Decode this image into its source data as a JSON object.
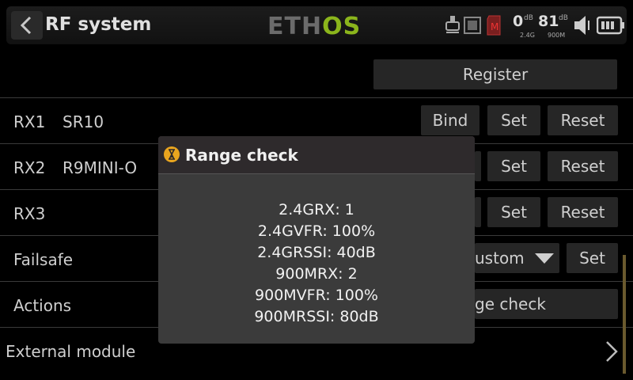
{
  "header": {
    "title": "RF system",
    "logo_part1": "ETH",
    "logo_part2": "OS",
    "telemetry": [
      {
        "value": "0",
        "unit": "dB",
        "band": "2.4G"
      },
      {
        "value": "81",
        "unit": "dB",
        "band": "900M"
      }
    ],
    "icons": [
      "joystick-icon",
      "record-icon",
      "memory-card-icon",
      "speaker-icon",
      "battery-icon"
    ]
  },
  "register_button": "Register",
  "receivers": [
    {
      "slot": "RX1",
      "name": "SR10",
      "bind": "Bind",
      "set": "Set",
      "reset": "Reset"
    },
    {
      "slot": "RX2",
      "name": "R9MINI-O",
      "set": "Set",
      "reset": "Reset"
    },
    {
      "slot": "RX3",
      "name": "",
      "set": "Set",
      "reset": "Reset"
    }
  ],
  "failsafe": {
    "label": "Failsafe",
    "mode": "ustom",
    "set": "Set"
  },
  "actions": {
    "label": "Actions",
    "button": "ge check"
  },
  "external_module": {
    "label": "External module"
  },
  "dialog": {
    "title": "Range check",
    "lines": [
      "2.4GRX: 1",
      "2.4GVFR: 100%",
      "2.4GRSSI: 40dB",
      "900MRX: 2",
      "900MVFR: 100%",
      "900MRSSI: 80dB"
    ]
  },
  "colors": {
    "accent_logo": "#8bb51c",
    "dialog_icon": "#e9a51f",
    "background": "#000000"
  }
}
